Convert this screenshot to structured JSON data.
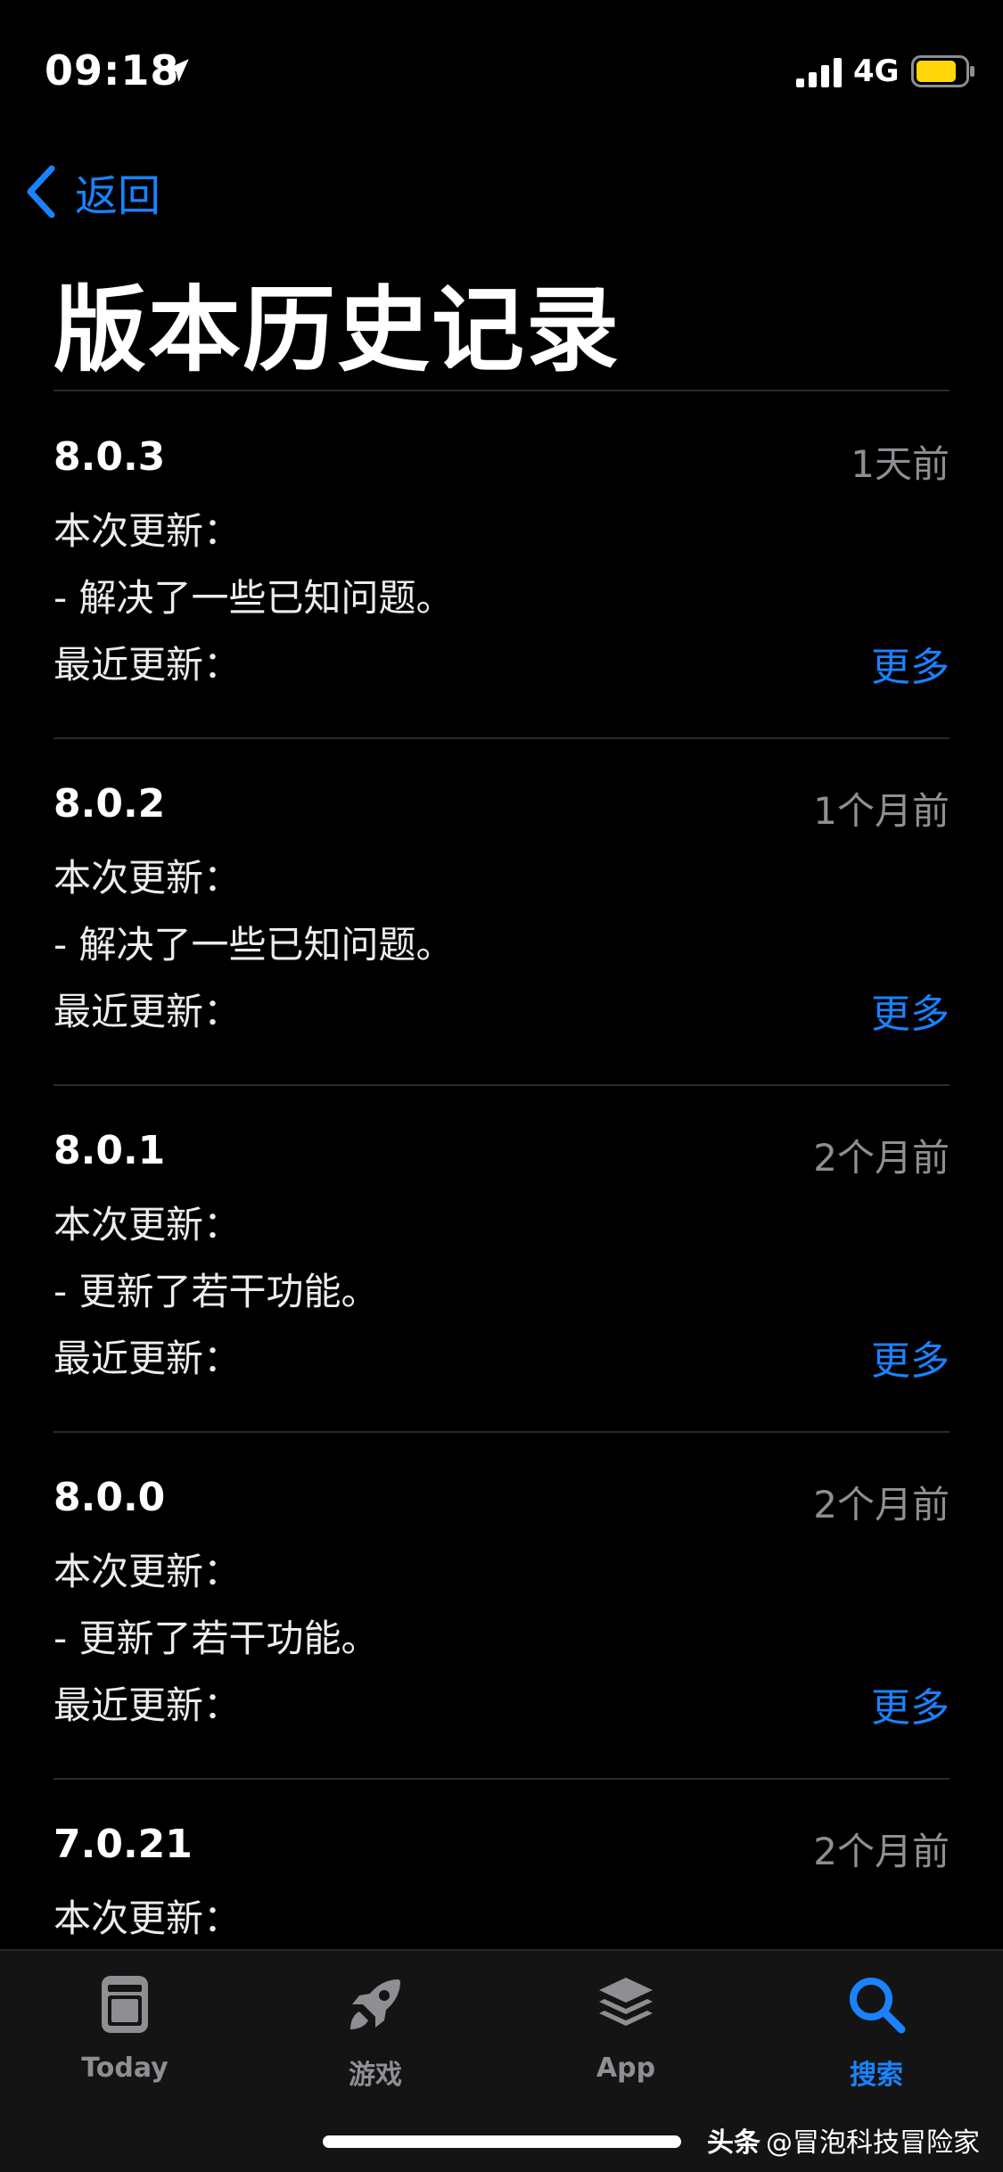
{
  "status_bar": {
    "time": "09:18",
    "network": "4G",
    "battery_color": "#ffd60a"
  },
  "nav": {
    "back_label": "返回"
  },
  "page": {
    "title": "版本历史记录"
  },
  "versions": [
    {
      "version": "8.0.3",
      "date": "1天前",
      "line1": "本次更新：",
      "line2": "- 解决了一些已知问题。",
      "line3": "最近更新：",
      "more": "更多"
    },
    {
      "version": "8.0.2",
      "date": "1个月前",
      "line1": "本次更新：",
      "line2": "- 解决了一些已知问题。",
      "line3": "最近更新：",
      "more": "更多"
    },
    {
      "version": "8.0.1",
      "date": "2个月前",
      "line1": "本次更新：",
      "line2": "- 更新了若干功能。",
      "line3": "最近更新：",
      "more": "更多"
    },
    {
      "version": "8.0.0",
      "date": "2个月前",
      "line1": "本次更新：",
      "line2": "- 更新了若干功能。",
      "line3": "最近更新：",
      "more": "更多"
    },
    {
      "version": "7.0.21",
      "date": "2个月前",
      "line1": "本次更新：",
      "line2": "",
      "line3": "",
      "more": ""
    }
  ],
  "tab_bar": {
    "tabs": [
      {
        "label": "Today",
        "icon": "today-icon",
        "active": false
      },
      {
        "label": "游戏",
        "icon": "rocket-icon",
        "active": false
      },
      {
        "label": "App",
        "icon": "layers-icon",
        "active": false
      },
      {
        "label": "搜索",
        "icon": "search-icon",
        "active": true
      }
    ]
  },
  "watermark": {
    "brand": "头条",
    "handle": "@冒泡科技冒险家"
  },
  "colors": {
    "accent": "#1a82ff",
    "secondary_text": "#8e8e93",
    "background": "#000000"
  }
}
